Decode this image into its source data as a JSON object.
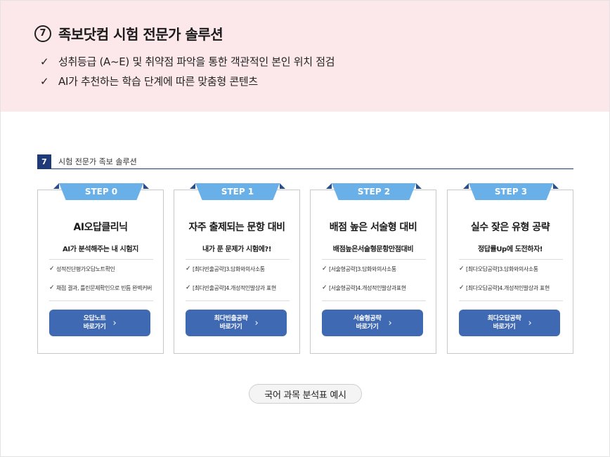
{
  "header": {
    "number": "7",
    "title": "족보닷컴 시험 전문가 솔루션",
    "bullets": [
      "성취등급 (A~E) 및 취약점 파악을 통한 객관적인 본인 위치 점검",
      "AI가 추천하는 학습 단계에 따른 맞춤형 콘텐츠"
    ]
  },
  "section": {
    "number": "7",
    "label": "시험 전문가 족보 솔루션"
  },
  "cards": [
    {
      "step": "STEP 0",
      "title": "AI오답클리닉",
      "subtitle": "AI가 분석해주는 내 시험지",
      "items": [
        "성적진단평가오답노트확인",
        "채점 결과, 틀린문제확인으로 빈틈 완벽커버"
      ],
      "button_line1": "오답노트",
      "button_line2": "바로가기"
    },
    {
      "step": "STEP 1",
      "title": "자주 출제되는 문항 대비",
      "subtitle": "내가 푼 문제가 시험에?!",
      "items": [
        "[최다빈출공략]3.담화와의사소통",
        "[최다빈출공략]4.개성적인발상과 표현"
      ],
      "button_line1": "최다빈출공략",
      "button_line2": "바로가기"
    },
    {
      "step": "STEP 2",
      "title": "배점 높은 서술형 대비",
      "subtitle": "배점높은서술형문항만점대비",
      "items": [
        "[서술형공략]3.담화와의사소통",
        "[서술형공략]4.개성적인발상과표현"
      ],
      "button_line1": "서술형공략",
      "button_line2": "바로가기"
    },
    {
      "step": "STEP 3",
      "title": "실수 잦은 유형 공략",
      "subtitle": "정답률Up에 도전하자!",
      "items": [
        "[최다오답공략]3.담화와의사소통",
        "[최다오답공략]4.개성적인발상과 표현"
      ],
      "button_line1": "최다오답공략",
      "button_line2": "바로가기"
    }
  ],
  "caption": "국어 과목 분석표 예시",
  "colors": {
    "header_bg": "#fce8ea",
    "ribbon": "#6ab0e8",
    "button": "#4069b3",
    "section_accent": "#1e3a78"
  },
  "icons": {
    "check": "check-icon",
    "arrow": "chevron-right-icon"
  }
}
